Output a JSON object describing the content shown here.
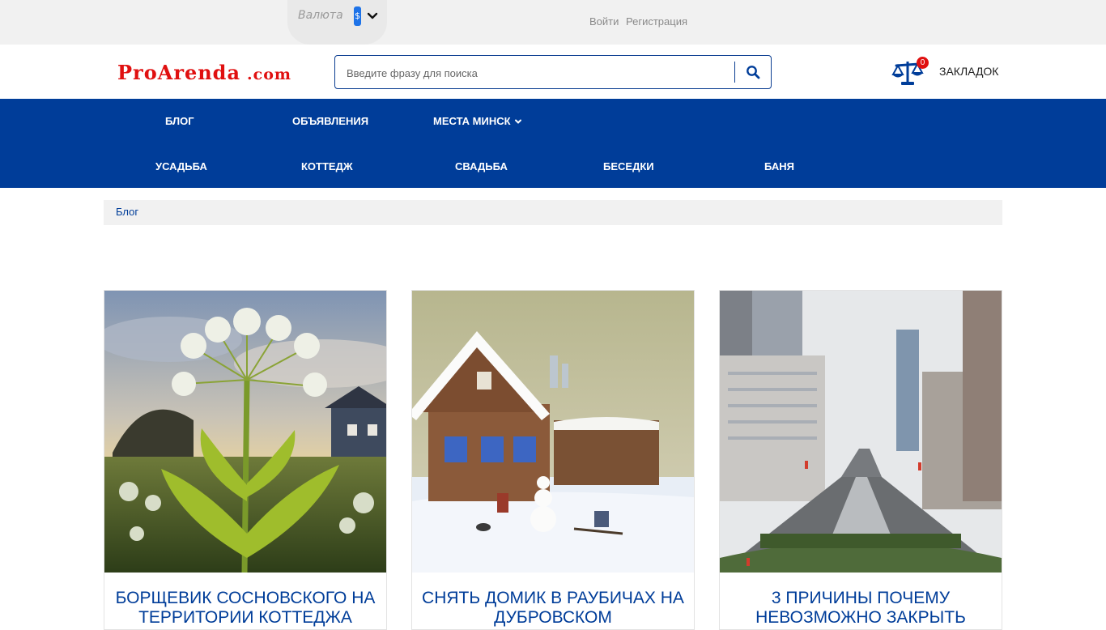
{
  "topbar": {
    "currency_label": "Валюта",
    "currency_symbol": "$",
    "login": "Войти",
    "register": "Регистрация"
  },
  "header": {
    "logo_text": "ProArenda",
    "logo_suffix": ".com",
    "search_placeholder": "Введите фразу для поиска",
    "bookmarks_count": "0",
    "bookmarks_label": "ЗАКЛАДОК"
  },
  "nav": {
    "row1": [
      "Блог",
      "Объявления",
      "Места Минск"
    ],
    "row2": [
      "Усадьба",
      "Коттедж",
      "Свадьба",
      "Беседки",
      "Баня"
    ]
  },
  "breadcrumb": {
    "item": "Блог"
  },
  "cards": [
    {
      "title": "Борщевик Сосновского на территории коттеджа"
    },
    {
      "title": "Снять домик в Раубичах на Дубровском"
    },
    {
      "title": "3 причины почему невозможно закрыть"
    }
  ],
  "colors": {
    "brand_blue": "#003d99",
    "logo_red": "#e01010",
    "accent_blue": "#1e73e8"
  }
}
